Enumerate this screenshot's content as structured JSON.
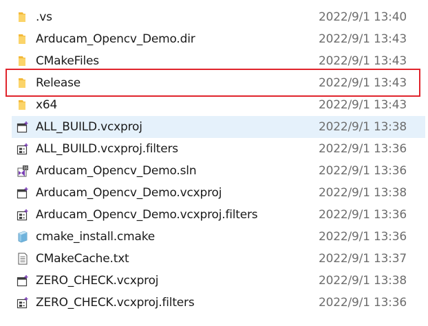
{
  "files": [
    {
      "name": ".vs",
      "date": "2022/9/1 13:40",
      "icon": "folder-icon"
    },
    {
      "name": "Arducam_Opencv_Demo.dir",
      "date": "2022/9/1 13:43",
      "icon": "folder-icon"
    },
    {
      "name": "CMakeFiles",
      "date": "2022/9/1 13:43",
      "icon": "folder-icon"
    },
    {
      "name": "Release",
      "date": "2022/9/1 13:43",
      "icon": "folder-icon"
    },
    {
      "name": "x64",
      "date": "2022/9/1 13:43",
      "icon": "folder-icon"
    },
    {
      "name": "ALL_BUILD.vcxproj",
      "date": "2022/9/1 13:38",
      "icon": "vcxproj-icon"
    },
    {
      "name": "ALL_BUILD.vcxproj.filters",
      "date": "2022/9/1 13:36",
      "icon": "vcxproj-filters-icon"
    },
    {
      "name": "Arducam_Opencv_Demo.sln",
      "date": "2022/9/1 13:36",
      "icon": "visual-studio-solution-icon"
    },
    {
      "name": "Arducam_Opencv_Demo.vcxproj",
      "date": "2022/9/1 13:38",
      "icon": "vcxproj-icon"
    },
    {
      "name": "Arducam_Opencv_Demo.vcxproj.filters",
      "date": "2022/9/1 13:36",
      "icon": "vcxproj-filters-icon"
    },
    {
      "name": "cmake_install.cmake",
      "date": "2022/9/1 13:36",
      "icon": "cmake-file-icon"
    },
    {
      "name": "CMakeCache.txt",
      "date": "2022/9/1 13:37",
      "icon": "text-file-icon"
    },
    {
      "name": "ZERO_CHECK.vcxproj",
      "date": "2022/9/1 13:38",
      "icon": "vcxproj-icon"
    },
    {
      "name": "ZERO_CHECK.vcxproj.filters",
      "date": "2022/9/1 13:36",
      "icon": "vcxproj-filters-icon"
    }
  ],
  "colors": {
    "hover_row": "#e5f1fb",
    "highlight_border": "#e0232b",
    "folder": "#f8c54a",
    "date_text": "#6d6d6d"
  }
}
